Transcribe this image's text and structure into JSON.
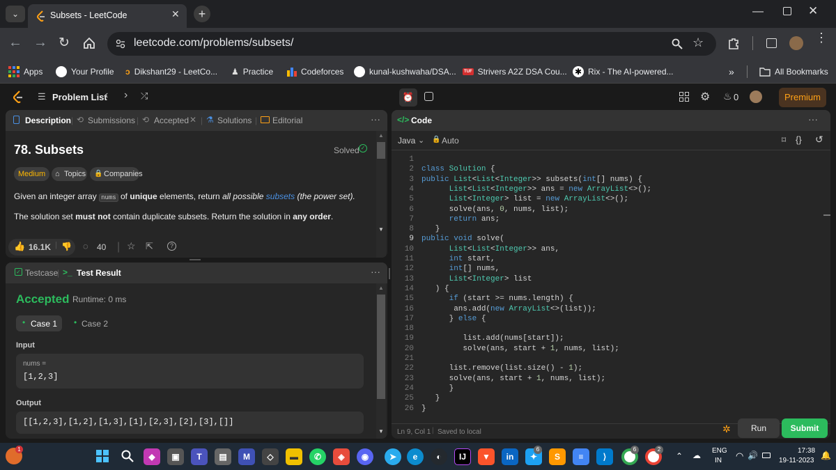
{
  "browser": {
    "tab_title": "Subsets - LeetCode",
    "url": "leetcode.com/problems/subsets/",
    "bookmarks": [
      "Apps",
      "Your Profile",
      "Dikshant29 - LeetCo...",
      "Practice",
      "Codeforces",
      "kunal-kushwaha/DSA...",
      "Strivers A2Z DSA Cou...",
      "Rix - The AI-powered..."
    ],
    "all_bookmarks": "All Bookmarks",
    "tuf_badge": "TUF"
  },
  "nav": {
    "problem_list": "Problem List",
    "coins": "0",
    "premium": "Premium"
  },
  "problem_tabs": [
    "Description",
    "Submissions",
    "Accepted",
    "Solutions",
    "Editorial"
  ],
  "problem": {
    "title": "78. Subsets",
    "status": "Solved",
    "difficulty": "Medium",
    "topics": "Topics",
    "companies": "Companies",
    "p1_a": "Given an integer array ",
    "p1_code": "nums",
    "p1_b": " of ",
    "p1_unique": "unique",
    "p1_c": " elements, return ",
    "p1_all": "all possible",
    "p1_subsets": "subsets",
    "p1_d": " (the power set).",
    "p2_a": "The solution set ",
    "p2_mustnot": "must not",
    "p2_b": " contain duplicate subsets. Return the solution in ",
    "p2_any": "any order",
    "p2_c": ".",
    "likes": "16.1K",
    "comments": "40"
  },
  "test_tabs": [
    "Testcase",
    "Test Result"
  ],
  "result": {
    "verdict": "Accepted",
    "runtime": "Runtime: 0 ms",
    "cases": [
      "Case 1",
      "Case 2"
    ],
    "input_label": "Input",
    "input_var": "nums =",
    "input_value": "[1,2,3]",
    "output_label": "Output",
    "output_value": "[[1,2,3],[1,2],[1,3],[1],[2,3],[2],[3],[]]"
  },
  "code": {
    "header": "Code",
    "language": "Java",
    "auto": "Auto",
    "lines": [
      "",
      "class Solution {",
      "public List<List<Integer>> subsets(int[] nums) {",
      "      List<List<Integer>> ans = new ArrayList<>();",
      "      List<Integer> list = new ArrayList<>();",
      "      solve(ans, 0, nums, list);",
      "      return ans;",
      "   }",
      "public void solve(",
      "      List<List<Integer>> ans,",
      "      int start,",
      "      int[] nums,",
      "      List<Integer> list",
      "   ) {",
      "      if (start >= nums.length) {",
      "       ans.add(new ArrayList<>(list));",
      "      } else {",
      "",
      "         list.add(nums[start]);",
      "         solve(ans, start + 1, nums, list);",
      "",
      "      list.remove(list.size() - 1);",
      "      solve(ans, start + 1, nums, list);",
      "      }",
      "   }",
      "}"
    ],
    "status": "Ln 9, Col 1",
    "saved": "Saved to local",
    "run": "Run",
    "submit": "Submit"
  },
  "taskbar": {
    "lang_top": "ENG",
    "lang_bottom": "IN",
    "time": "17:38",
    "date": "19-11-2023",
    "notif_count": "1",
    "twitter_badge": "6",
    "chrome_badge1": "6",
    "chrome_badge2": "2"
  },
  "colors": {
    "accent_orange": "#ffa116",
    "accepted_green": "#2cbb5d",
    "easy_teal": "#00b8a3",
    "link_blue": "#4a90e2"
  }
}
